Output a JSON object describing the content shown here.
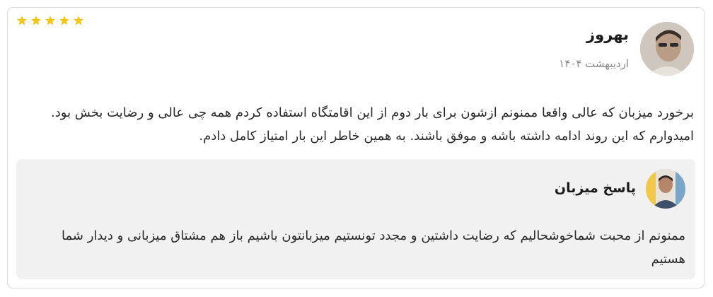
{
  "review": {
    "rating": 5,
    "rating_max": 5,
    "star_color": "#f5c518",
    "reviewer_name": "بهروز",
    "date": "اردیبهشت ۱۴۰۴",
    "text": "برخورد میزبان که عالی واقعا ممنونم ازشون برای بار دوم از این اقامتگاه استفاده کردم همه چی عالی و رضایت بخش بود. امیدوارم که این روند ادامه داشته باشه و موفق باشند. به همین خاطر این بار امتیاز کامل دادم."
  },
  "host_reply": {
    "title": "پاسخ میزبان",
    "text": "ممنونم از محبت شماخوشحالیم که رضایت داشتین و مجدد تونستیم میزبانتون باشیم باز هم مشتاق میزبانی و دیدار شما هستیم",
    "background": "#f1f1f1"
  }
}
